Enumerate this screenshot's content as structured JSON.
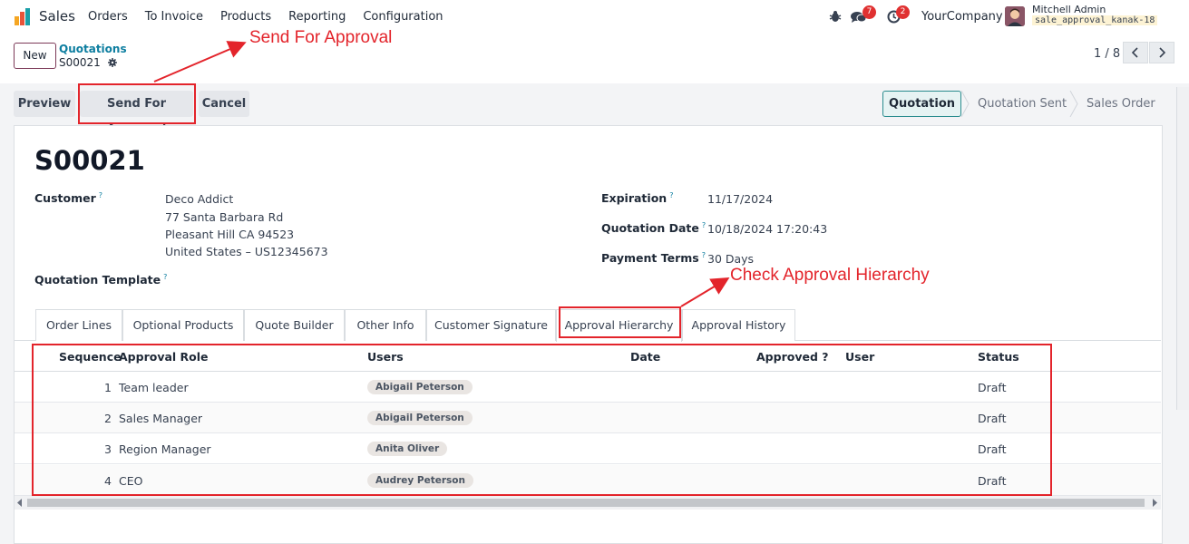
{
  "navbar": {
    "app_name": "Sales",
    "menu": [
      "Orders",
      "To Invoice",
      "Products",
      "Reporting",
      "Configuration"
    ],
    "messages_count": "7",
    "activities_count": "2",
    "company": "YourCompany",
    "user_name": "Mitchell Admin",
    "database": "sale_approval_kanak-18"
  },
  "control_panel": {
    "new_label": "New",
    "breadcrumb_parent": "Quotations",
    "breadcrumb_current": "S00021",
    "pager": "1 / 8"
  },
  "actions": {
    "preview": "Preview",
    "send_for_approval": "Send For Approval",
    "cancel": "Cancel"
  },
  "statusbar": {
    "stages": [
      "Quotation",
      "Quotation Sent",
      "Sales Order"
    ],
    "active": "Quotation"
  },
  "form": {
    "name": "S00021",
    "customer_label": "Customer",
    "customer_lines": [
      "Deco Addict",
      "77 Santa Barbara Rd",
      "Pleasant Hill CA 94523",
      "United States – US12345673"
    ],
    "quotation_template_label": "Quotation Template",
    "expiration_label": "Expiration",
    "expiration_value": "11/17/2024",
    "quotation_date_label": "Quotation Date",
    "quotation_date_value": "10/18/2024 17:20:43",
    "payment_terms_label": "Payment Terms",
    "payment_terms_value": "30 Days",
    "help_mark": "?"
  },
  "tabs": [
    "Order Lines",
    "Optional Products",
    "Quote Builder",
    "Other Info",
    "Customer Signature",
    "Approval Hierarchy",
    "Approval History"
  ],
  "active_tab": "Approval Hierarchy",
  "table": {
    "columns": [
      "Sequence",
      "Approval Role",
      "Users",
      "Date",
      "Approved ?",
      "User",
      "Status"
    ],
    "rows": [
      {
        "sequence": "1",
        "role": "Team leader",
        "user": "Abigail Peterson",
        "status": "Draft"
      },
      {
        "sequence": "2",
        "role": "Sales Manager",
        "user": "Abigail Peterson",
        "status": "Draft"
      },
      {
        "sequence": "3",
        "role": "Region Manager",
        "user": "Anita Oliver",
        "status": "Draft"
      },
      {
        "sequence": "4",
        "role": "CEO",
        "user": "Audrey Peterson",
        "status": "Draft"
      }
    ]
  },
  "annotations": {
    "send_for_approval": "Send For Approval",
    "check_hierarchy": "Check Approval Hierarchy"
  },
  "colors": {
    "brand": "#7c3a58",
    "link": "#0d7ea0",
    "annotation": "#e3242b",
    "badge": "#e03131"
  }
}
